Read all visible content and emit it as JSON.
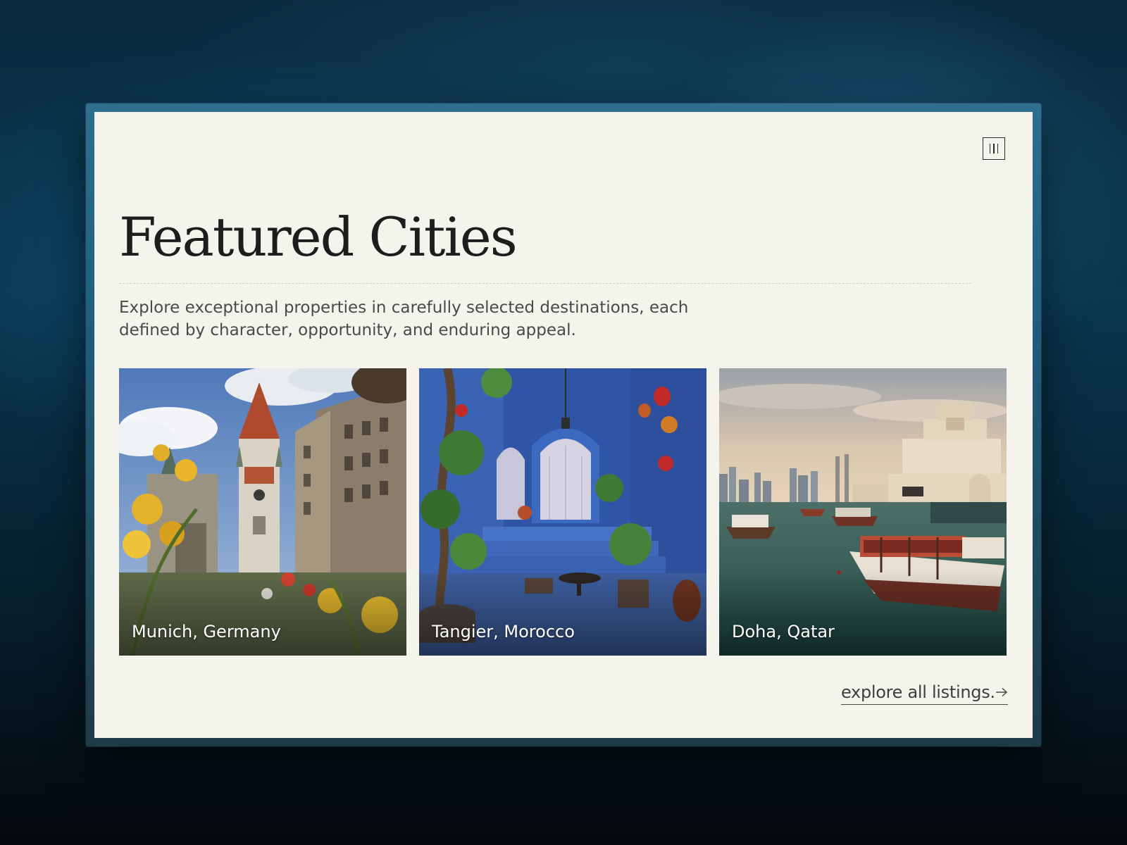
{
  "page": {
    "title": "Featured Cities",
    "subtitle": "Explore exceptional properties in carefully selected destinations, each defined by character, opportunity, and enduring appeal.",
    "menu_icon": "menu-icon"
  },
  "cities": [
    {
      "label": "Munich, Germany"
    },
    {
      "label": "Tangier, Morocco"
    },
    {
      "label": "Doha, Qatar"
    }
  ],
  "footer": {
    "link_label": "explore all listings.",
    "link_icon": "arrow-right-icon"
  },
  "colors": {
    "panel_background": "#f4f3ec",
    "title_text": "#1d1d1d",
    "body_text": "#4a4a46",
    "backdrop": "#093650"
  }
}
